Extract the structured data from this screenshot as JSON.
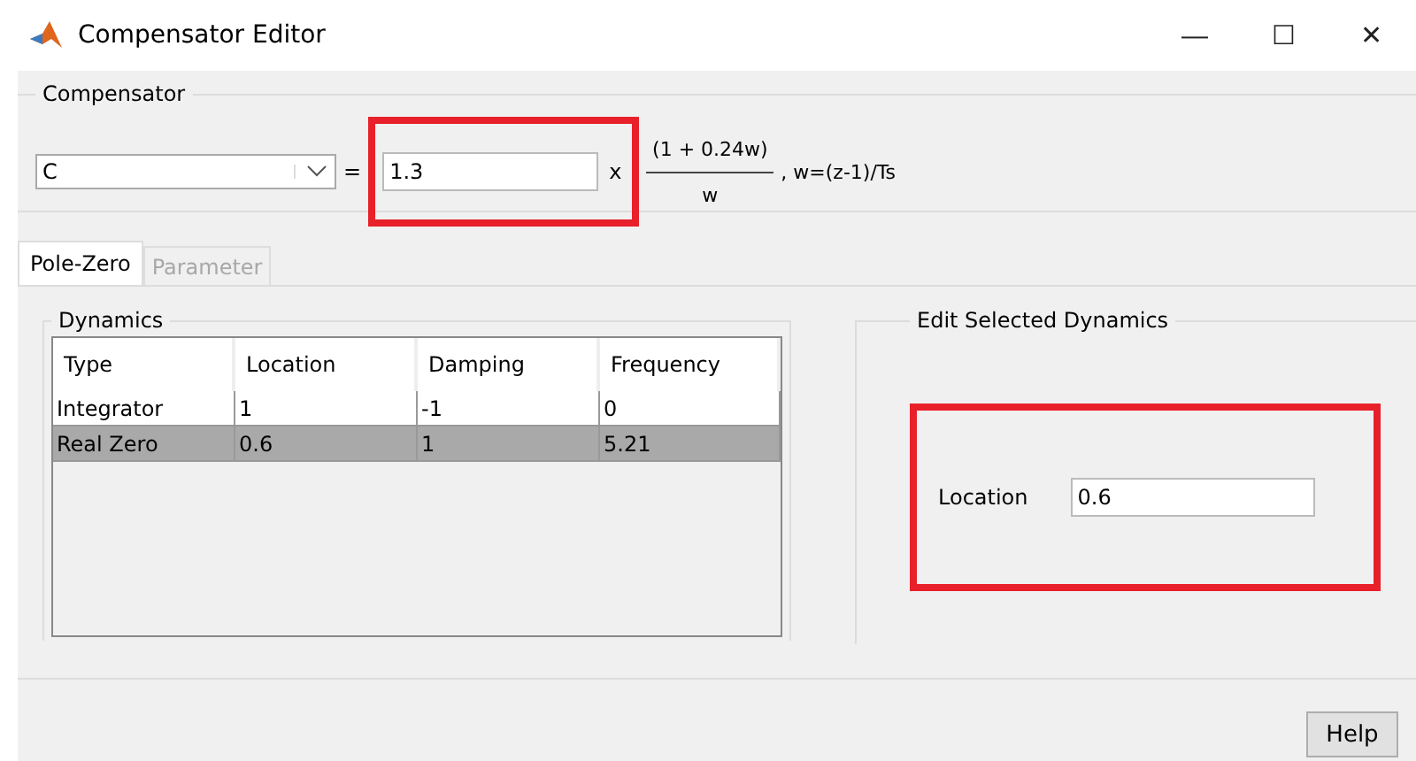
{
  "window": {
    "title": "Compensator Editor",
    "controls": [
      "—",
      "☐",
      "✕"
    ]
  },
  "compensator": {
    "label": "Compensator",
    "name": "C",
    "equals": "=",
    "gain": "1.3",
    "gain_highlighted": true,
    "times": "x",
    "numerator": "(1 + 0.24w)",
    "denominator": "w",
    "note": ", w=(z-1)/Ts"
  },
  "tabs": [
    {
      "label": "Pole-Zero",
      "selected": true
    },
    {
      "label": "Parameter",
      "selected": false
    }
  ],
  "dynamics": {
    "label": "Dynamics",
    "columns": [
      "Type",
      "Location",
      "Damping",
      "Frequency"
    ],
    "rows": [
      {
        "cells": [
          "Integrator",
          "1",
          "-1",
          "0"
        ],
        "selected": false
      },
      {
        "cells": [
          "Real Zero",
          "0.6",
          "1",
          "5.21"
        ],
        "selected": true
      }
    ]
  },
  "edit": {
    "label": "Edit Selected Dynamics",
    "field_label": "Location",
    "value": "0.6",
    "highlighted": true
  },
  "buttons": [
    "Help"
  ]
}
